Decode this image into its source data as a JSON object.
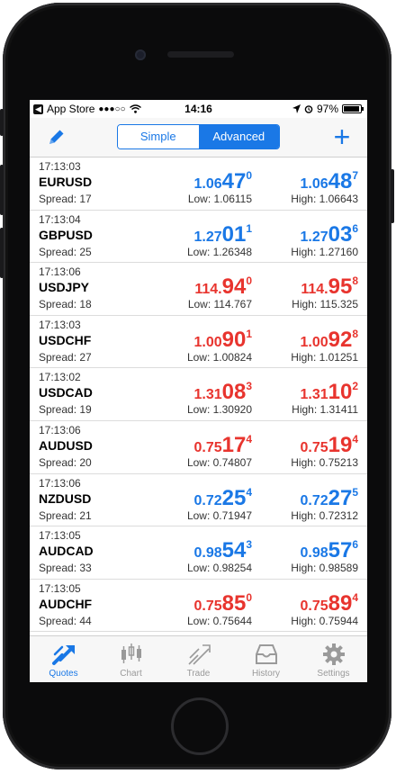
{
  "status_bar": {
    "back_app": "App Store",
    "signal": "●●●○○",
    "time": "14:16",
    "battery": "97%",
    "battery_level": 0.97
  },
  "navbar": {
    "segments": [
      "Simple",
      "Advanced"
    ],
    "selected_segment": "Advanced",
    "add_label": "+"
  },
  "colors": {
    "accent": "#1a78e6",
    "up": "#1a78e6",
    "down": "#e8342e"
  },
  "quotes": [
    {
      "time": "17:13:03",
      "symbol": "EURUSD",
      "spread": "Spread: 17",
      "color": "blue",
      "bid": {
        "a": "1.06",
        "b": "47",
        "c": "0"
      },
      "ask": {
        "a": "1.06",
        "b": "48",
        "c": "7"
      },
      "low": "Low: 1.06115",
      "high": "High: 1.06643"
    },
    {
      "time": "17:13:04",
      "symbol": "GBPUSD",
      "spread": "Spread: 25",
      "color": "blue",
      "bid": {
        "a": "1.27",
        "b": "01",
        "c": "1"
      },
      "ask": {
        "a": "1.27",
        "b": "03",
        "c": "6"
      },
      "low": "Low: 1.26348",
      "high": "High: 1.27160"
    },
    {
      "time": "17:13:06",
      "symbol": "USDJPY",
      "spread": "Spread: 18",
      "color": "red",
      "bid": {
        "a": "114.",
        "b": "94",
        "c": "0"
      },
      "ask": {
        "a": "114.",
        "b": "95",
        "c": "8"
      },
      "low": "Low: 114.767",
      "high": "High: 115.325"
    },
    {
      "time": "17:13:03",
      "symbol": "USDCHF",
      "spread": "Spread: 27",
      "color": "red",
      "bid": {
        "a": "1.00",
        "b": "90",
        "c": "1"
      },
      "ask": {
        "a": "1.00",
        "b": "92",
        "c": "8"
      },
      "low": "Low: 1.00824",
      "high": "High: 1.01251"
    },
    {
      "time": "17:13:02",
      "symbol": "USDCAD",
      "spread": "Spread: 19",
      "color": "red",
      "bid": {
        "a": "1.31",
        "b": "08",
        "c": "3"
      },
      "ask": {
        "a": "1.31",
        "b": "10",
        "c": "2"
      },
      "low": "Low: 1.30920",
      "high": "High: 1.31411"
    },
    {
      "time": "17:13:06",
      "symbol": "AUDUSD",
      "spread": "Spread: 20",
      "color": "red",
      "bid": {
        "a": "0.75",
        "b": "17",
        "c": "4"
      },
      "ask": {
        "a": "0.75",
        "b": "19",
        "c": "4"
      },
      "low": "Low: 0.74807",
      "high": "High: 0.75213"
    },
    {
      "time": "17:13:06",
      "symbol": "NZDUSD",
      "spread": "Spread: 21",
      "color": "blue",
      "bid": {
        "a": "0.72",
        "b": "25",
        "c": "4"
      },
      "ask": {
        "a": "0.72",
        "b": "27",
        "c": "5"
      },
      "low": "Low: 0.71947",
      "high": "High: 0.72312"
    },
    {
      "time": "17:13:05",
      "symbol": "AUDCAD",
      "spread": "Spread: 33",
      "color": "blue",
      "bid": {
        "a": "0.98",
        "b": "54",
        "c": "3"
      },
      "ask": {
        "a": "0.98",
        "b": "57",
        "c": "6"
      },
      "low": "Low: 0.98254",
      "high": "High: 0.98589"
    },
    {
      "time": "17:13:05",
      "symbol": "AUDCHF",
      "spread": "Spread: 44",
      "color": "red",
      "bid": {
        "a": "0.75",
        "b": "85",
        "c": "0"
      },
      "ask": {
        "a": "0.75",
        "b": "89",
        "c": "4"
      },
      "low": "Low: 0.75644",
      "high": "High: 0.75944"
    }
  ],
  "tabbar": {
    "active": "Quotes",
    "tabs": [
      {
        "label": "Quotes",
        "icon": "quotes-icon"
      },
      {
        "label": "Chart",
        "icon": "chart-icon"
      },
      {
        "label": "Trade",
        "icon": "trade-icon"
      },
      {
        "label": "History",
        "icon": "history-icon"
      },
      {
        "label": "Settings",
        "icon": "settings-icon"
      }
    ]
  }
}
